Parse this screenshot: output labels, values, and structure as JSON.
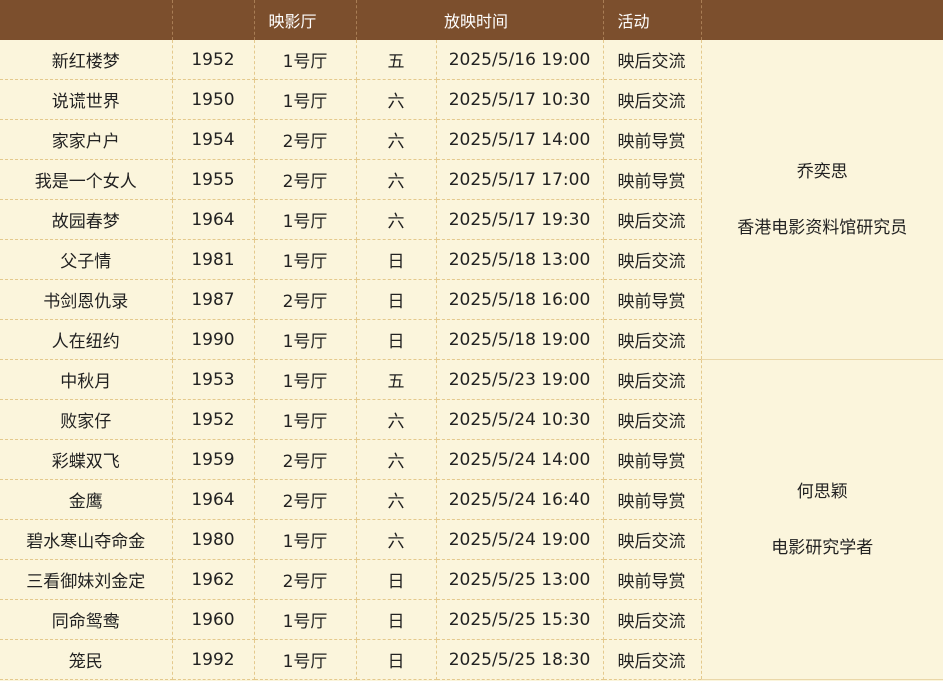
{
  "header": [
    "",
    "",
    "映影厅",
    "放映时间",
    "",
    "活动",
    ""
  ],
  "groups": [
    {
      "host": {
        "name": "乔奕思",
        "title": "香港电影资料馆研究员"
      },
      "rows": [
        {
          "film": "新红楼梦",
          "year": "1952",
          "hall": "1号厅",
          "day": "五",
          "time": "2025/5/16 19:00",
          "event": "映后交流"
        },
        {
          "film": "说谎世界",
          "year": "1950",
          "hall": "1号厅",
          "day": "六",
          "time": "2025/5/17 10:30",
          "event": "映后交流"
        },
        {
          "film": "家家户户",
          "year": "1954",
          "hall": "2号厅",
          "day": "六",
          "time": "2025/5/17 14:00",
          "event": "映前导赏"
        },
        {
          "film": "我是一个女人",
          "year": "1955",
          "hall": "2号厅",
          "day": "六",
          "time": "2025/5/17 17:00",
          "event": "映前导赏"
        },
        {
          "film": "故园春梦",
          "year": "1964",
          "hall": "1号厅",
          "day": "六",
          "time": "2025/5/17 19:30",
          "event": "映后交流"
        },
        {
          "film": "父子情",
          "year": "1981",
          "hall": "1号厅",
          "day": "日",
          "time": "2025/5/18 13:00",
          "event": "映后交流"
        },
        {
          "film": "书剑恩仇录",
          "year": "1987",
          "hall": "2号厅",
          "day": "日",
          "time": "2025/5/18 16:00",
          "event": "映前导赏"
        },
        {
          "film": "人在纽约",
          "year": "1990",
          "hall": "1号厅",
          "day": "日",
          "time": "2025/5/18 19:00",
          "event": "映后交流"
        }
      ]
    },
    {
      "host": {
        "name": "何思颖",
        "title": "电影研究学者"
      },
      "rows": [
        {
          "film": "中秋月",
          "year": "1953",
          "hall": "1号厅",
          "day": "五",
          "time": "2025/5/23 19:00",
          "event": "映后交流"
        },
        {
          "film": "败家仔",
          "year": "1952",
          "hall": "1号厅",
          "day": "六",
          "time": "2025/5/24 10:30",
          "event": "映后交流"
        },
        {
          "film": "彩蝶双飞",
          "year": "1959",
          "hall": "2号厅",
          "day": "六",
          "time": "2025/5/24 14:00",
          "event": "映前导赏"
        },
        {
          "film": "金鹰",
          "year": "1964",
          "hall": "2号厅",
          "day": "六",
          "time": "2025/5/24 16:40",
          "event": "映前导赏"
        },
        {
          "film": "碧水寒山夺命金",
          "year": "1980",
          "hall": "1号厅",
          "day": "六",
          "time": "2025/5/24 19:00",
          "event": "映后交流"
        },
        {
          "film": "三看御妹刘金定",
          "year": "1962",
          "hall": "2号厅",
          "day": "日",
          "time": "2025/5/25 13:00",
          "event": "映前导赏"
        },
        {
          "film": "同命鸳鸯",
          "year": "1960",
          "hall": "1号厅",
          "day": "日",
          "time": "2025/5/25 15:30",
          "event": "映后交流"
        },
        {
          "film": "笼民",
          "year": "1992",
          "hall": "1号厅",
          "day": "日",
          "time": "2025/5/25 18:30",
          "event": "映后交流"
        }
      ]
    }
  ],
  "colors": {
    "header_bg": "#7c4f2d",
    "body_bg": "#fbf5dc",
    "grid": "#e4c98c"
  }
}
